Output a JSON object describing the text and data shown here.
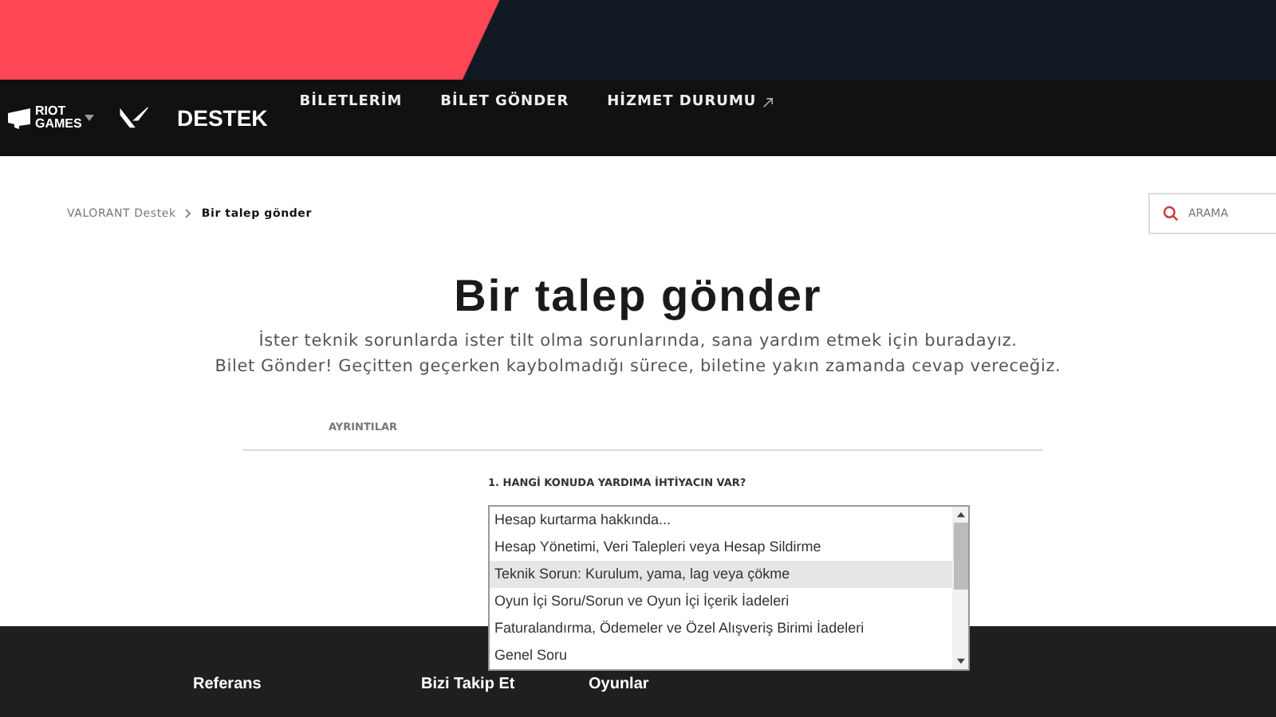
{
  "header": {
    "brand": "RIOT GAMES",
    "section": "DESTEK",
    "nav": [
      {
        "label": "BİLETLERİM",
        "external": false
      },
      {
        "label": "BİLET GÖNDER",
        "external": false
      },
      {
        "label": "HİZMET DURUMU",
        "external": true
      }
    ]
  },
  "breadcrumb": [
    "VALORANT Destek",
    "Bir talep gönder"
  ],
  "search": {
    "placeholder": "ARAMA"
  },
  "title": "Bir talep gönder",
  "intro": [
    "İster teknik sorunlarda ister tilt olma sorunlarında, sana yardım etmek için buradayız.",
    "Bilet Gönder! Geçitten geçerken kaybolmadığı sürece, biletine yakın zamanda cevap vereceğiz."
  ],
  "section": "AYRINTILAR",
  "question": "1. HANGİ KONUDA YARDIMA İHTİYACIN VAR?",
  "options": [
    {
      "label": "Hesap kurtarma hakkında...",
      "selected": false
    },
    {
      "label": "Hesap Yönetimi, Veri Talepleri veya Hesap Sildirme",
      "selected": false
    },
    {
      "label": "Teknik Sorun: Kurulum, yama, lag veya çökme",
      "selected": true
    },
    {
      "label": "Oyun İçi Soru/Sorun ve Oyun İçi İçerik İadeleri",
      "selected": false
    },
    {
      "label": "Faturalandırma, Ödemeler ve Özel Alışveriş Birimi İadeleri",
      "selected": false
    },
    {
      "label": "Genel Soru",
      "selected": false
    }
  ],
  "footer": [
    "Referans",
    "Bizi Takip Et",
    "Oyunlar"
  ]
}
